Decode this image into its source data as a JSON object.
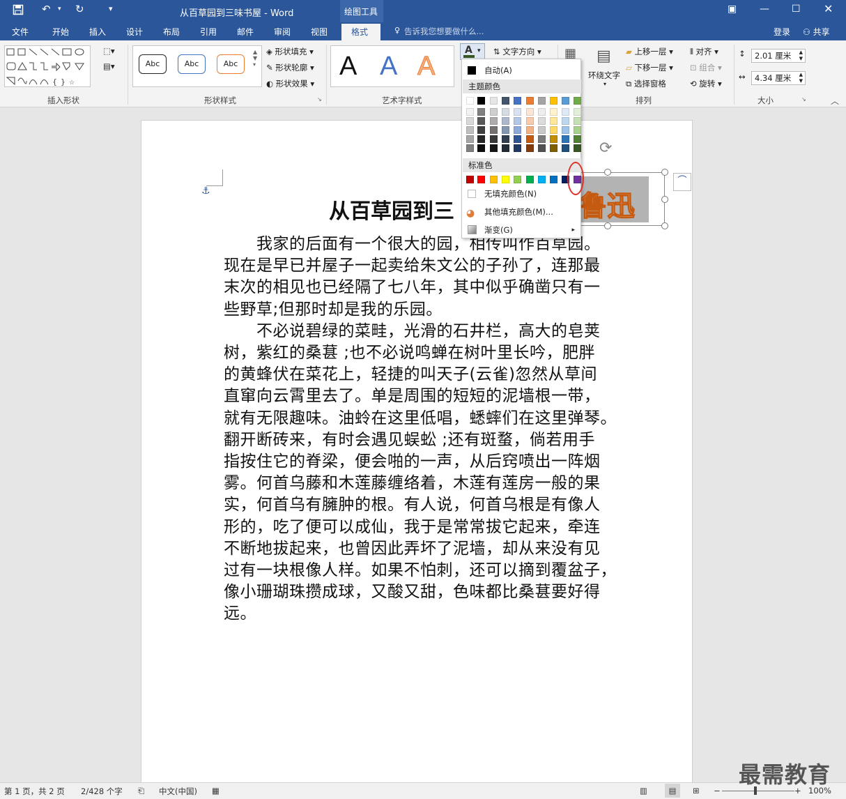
{
  "app": {
    "window_title": "从百草园到三味书屋 - Word",
    "context_tab": "绘图工具",
    "login": "登录",
    "share": "共享"
  },
  "tabs": [
    "文件",
    "开始",
    "插入",
    "设计",
    "布局",
    "引用",
    "邮件",
    "审阅",
    "视图",
    "格式"
  ],
  "active_tab": "格式",
  "tell_me": "告诉我您想要做什么...",
  "ribbon": {
    "groups": [
      "插入形状",
      "形状样式",
      "艺术字样式",
      "排列",
      "大小"
    ],
    "shape_fill": "形状填充",
    "shape_outline": "形状轮廓",
    "shape_effects": "形状效果",
    "style_abc": [
      "Abc",
      "Abc",
      "Abc"
    ],
    "wordart_letters": [
      "A",
      "A",
      "A"
    ],
    "text_direction": "文字方向",
    "wrap_text": "环绕文字",
    "bring_forward": "上移一层",
    "send_backward": "下移一层",
    "selection_pane": "选择窗格",
    "align": "对齐",
    "group": "组合",
    "rotate": "旋转",
    "height": "2.01 厘米",
    "width": "4.34 厘米"
  },
  "color_menu": {
    "automatic": "自动(A)",
    "theme_colors_label": "主题颜色",
    "standard_colors_label": "标准色",
    "no_fill": "无填充颜色(N)",
    "more_colors": "其他填充颜色(M)...",
    "gradient": "渐变(G)",
    "theme_top": [
      "#ffffff",
      "#000000",
      "#e7e6e6",
      "#44546a",
      "#4472c4",
      "#ed7d31",
      "#a5a5a5",
      "#ffc000",
      "#5b9bd5",
      "#70ad47"
    ],
    "theme_shades": [
      [
        "#f2f2f2",
        "#d9d9d9",
        "#bfbfbf",
        "#a6a6a6",
        "#808080"
      ],
      [
        "#808080",
        "#595959",
        "#404040",
        "#262626",
        "#0d0d0d"
      ],
      [
        "#d0cece",
        "#aeabab",
        "#757171",
        "#3a3838",
        "#171616"
      ],
      [
        "#d6dce4",
        "#adb9ca",
        "#8496b0",
        "#333f4f",
        "#222a35"
      ],
      [
        "#d9e2f3",
        "#b4c7e7",
        "#8eaadb",
        "#2f5597",
        "#1f3864"
      ],
      [
        "#fbe5d6",
        "#f8cbad",
        "#f4b183",
        "#c55a11",
        "#843c0c"
      ],
      [
        "#ededed",
        "#dbdbdb",
        "#c9c9c9",
        "#7b7b7b",
        "#525252"
      ],
      [
        "#fff2cc",
        "#ffe699",
        "#ffd966",
        "#bf8f00",
        "#7f6000"
      ],
      [
        "#deebf7",
        "#bdd7ee",
        "#9dc3e6",
        "#2e75b6",
        "#1f4e79"
      ],
      [
        "#e2f0d9",
        "#c5e0b4",
        "#a9d18e",
        "#548235",
        "#385723"
      ]
    ],
    "standard": [
      "#c00000",
      "#ff0000",
      "#ffc000",
      "#ffff00",
      "#92d050",
      "#00b050",
      "#00b0f0",
      "#0070c0",
      "#002060",
      "#7030a0"
    ]
  },
  "document": {
    "title": "从百草园到三",
    "wordart_text": "鲁迅",
    "lines": [
      "　　我家的后面有一个很大的园，相传叫作百草园。",
      "现在是早已并屋子一起卖给朱文公的子孙了，连那最",
      "末次的相见也已经隔了七八年，其中似乎确凿只有一",
      "些野草;但那时却是我的乐园。",
      "　　不必说碧绿的菜畦，光滑的石井栏，高大的皂荚",
      "树，紫红的桑葚 ;也不必说鸣蝉在树叶里长吟，肥胖",
      "的黄蜂伏在菜花上，轻捷的叫天子(云雀)忽然从草间",
      "直窜向云霄里去了。单是周围的短短的泥墙根一带，",
      "就有无限趣味。油蛉在这里低唱，蟋蟀们在这里弹琴。",
      "翻开断砖来，有时会遇见蜈蚣 ;还有斑蝥，倘若用手",
      "指按住它的脊梁，便会啪的一声，从后窍喷出一阵烟",
      "雾。何首乌藤和木莲藤缠络着，木莲有莲房一般的果",
      "实，何首乌有臃肿的根。有人说，何首乌根是有像人",
      "形的，吃了便可以成仙，我于是常常拔它起来，牵连",
      "不断地拔起来，也曾因此弄坏了泥墙，却从来没有见",
      "过有一块根像人样。如果不怕刺，还可以摘到覆盆子，",
      "像小珊瑚珠攒成球，又酸又甜，色味都比桑葚要好得",
      "远。"
    ]
  },
  "status": {
    "page": "第 1 页，共 2 页",
    "words": "2/428 个字",
    "language": "中文(中国)",
    "zoom": "100%"
  },
  "watermark": "最需教育"
}
